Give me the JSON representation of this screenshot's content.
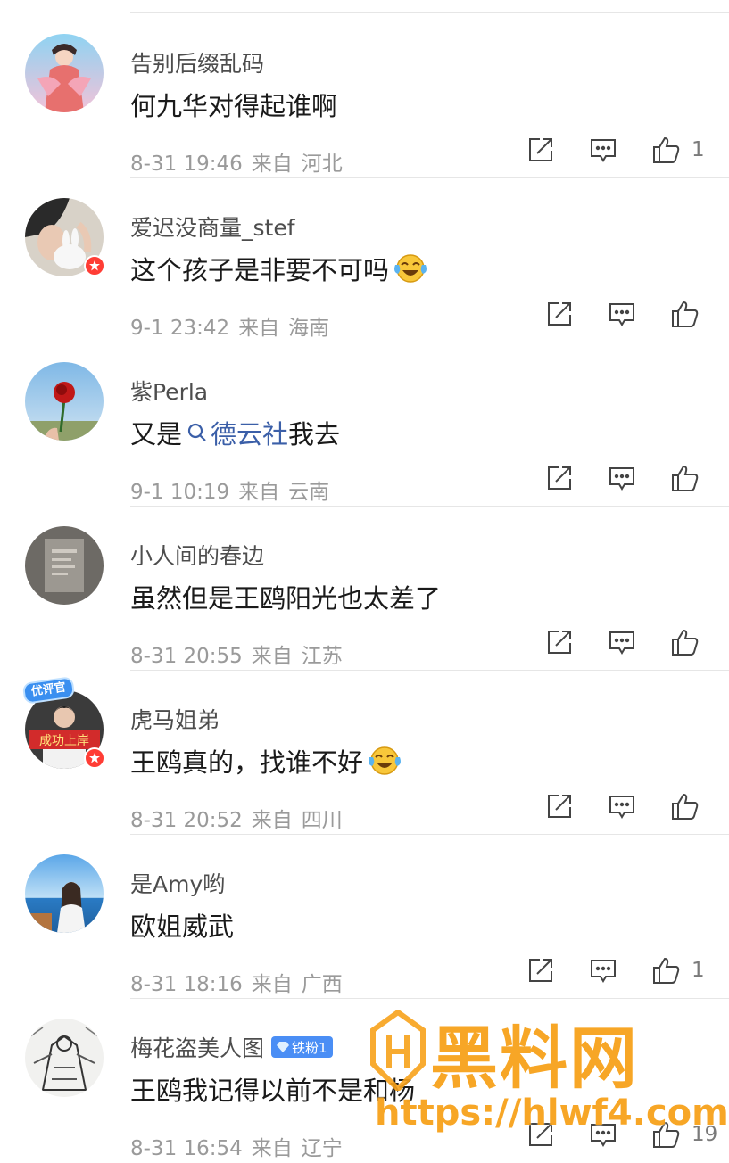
{
  "comments": [
    {
      "username": "告别后缀乱码",
      "text": "何九华对得起谁啊",
      "date": "8-31 19:46",
      "from_label": "来自",
      "location": "河北",
      "likes": "1",
      "avatar_icon": "avatar-illustrated-woman"
    },
    {
      "username": "爱迟没商量_stef",
      "text": "这个孩子是非要不可吗",
      "date": "9-1 23:42",
      "from_label": "来自",
      "location": "海南",
      "likes": "",
      "avatar_icon": "avatar-person-with-bunny",
      "emoji": "laugh-cry-emoji"
    },
    {
      "username": "紫Perla",
      "text_prefix": "又是",
      "topic": "德云社",
      "text_suffix": "我去",
      "date": "9-1 10:19",
      "from_label": "来自",
      "location": "云南",
      "likes": "",
      "avatar_icon": "avatar-red-rose"
    },
    {
      "username": "小人间的春边",
      "text": "虽然但是王鸥阳光也太差了",
      "date": "8-31 20:55",
      "from_label": "来自",
      "location": "江苏",
      "likes": "",
      "avatar_icon": "avatar-gray-photo"
    },
    {
      "username": "虎马姐弟",
      "text": "王鸥真的，找谁不好",
      "date": "8-31 20:52",
      "from_label": "来自",
      "location": "四川",
      "likes": "",
      "avatar_icon": "avatar-person-with-banner",
      "badge_label": "优评官",
      "banner_text": "成功上岸",
      "emoji": "laugh-cry-emoji"
    },
    {
      "username": "是Amy哟",
      "text": "欧姐威武",
      "date": "8-31 18:16",
      "from_label": "来自",
      "location": "广西",
      "likes": "1",
      "avatar_icon": "avatar-girl-by-sea"
    },
    {
      "username": "梅花盗美人图",
      "fan_badge": "铁粉1",
      "text": "王鸥我记得以前不是和杨",
      "date": "8-31 16:54",
      "from_label": "来自",
      "location": "辽宁",
      "likes": "19",
      "avatar_icon": "avatar-sketch-warrior"
    }
  ],
  "watermark": {
    "title": "黑料网",
    "url": "https://hlwf4.com"
  },
  "colors": {
    "topic_link": "#3b5fa8",
    "watermark": "#f7a21b",
    "verified_badge": "#ff3d35",
    "fan_badge": "#4a8ef5"
  }
}
